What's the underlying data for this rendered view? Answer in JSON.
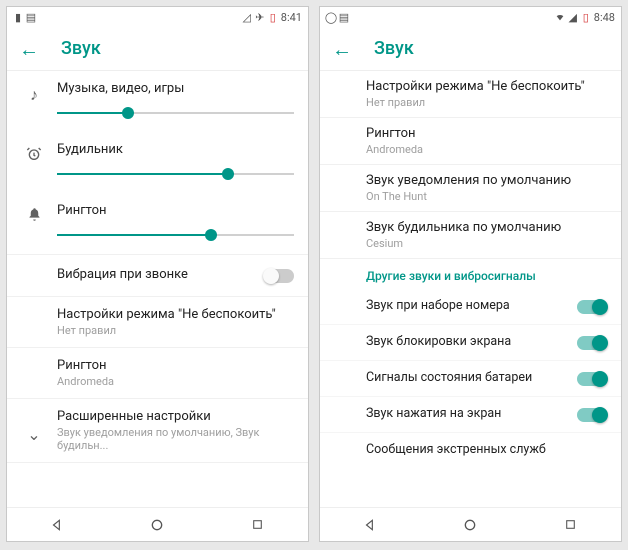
{
  "colors": {
    "accent": "#009688"
  },
  "left": {
    "statusbar": {
      "time": "8:41"
    },
    "appbar": {
      "title": "Звук"
    },
    "sliders": [
      {
        "icon": "music-note",
        "label": "Музыка, видео, игры",
        "value": 30
      },
      {
        "icon": "alarm-clock",
        "label": "Будильник",
        "value": 72
      },
      {
        "icon": "bell",
        "label": "Рингтон",
        "value": 65
      }
    ],
    "vibrate": {
      "label": "Вибрация при звонке",
      "on": false
    },
    "dnd": {
      "title": "Настройки режима \"Не беспокоить\"",
      "sub": "Нет правил"
    },
    "ringtone": {
      "title": "Рингтон",
      "sub": "Andromeda"
    },
    "advanced": {
      "title": "Расширенные настройки",
      "sub": "Звук уведомления по умолчанию, Звук будильн..."
    }
  },
  "right": {
    "statusbar": {
      "time": "8:48"
    },
    "appbar": {
      "title": "Звук"
    },
    "dnd": {
      "title": "Настройки режима \"Не беспокоить\"",
      "sub": "Нет правил"
    },
    "ringtone": {
      "title": "Рингтон",
      "sub": "Andromeda"
    },
    "notif": {
      "title": "Звук уведомления по умолчанию",
      "sub": "On The Hunt"
    },
    "alarm": {
      "title": "Звук будильника по умолчанию",
      "sub": "Cesium"
    },
    "section": "Другие звуки и вибросигналы",
    "toggles": [
      {
        "label": "Звук при наборе номера",
        "on": true
      },
      {
        "label": "Звук блокировки экрана",
        "on": true
      },
      {
        "label": "Сигналы состояния батареи",
        "on": true
      },
      {
        "label": "Звук нажатия на экран",
        "on": true
      }
    ],
    "emergency": {
      "label": "Сообщения экстренных служб"
    }
  }
}
